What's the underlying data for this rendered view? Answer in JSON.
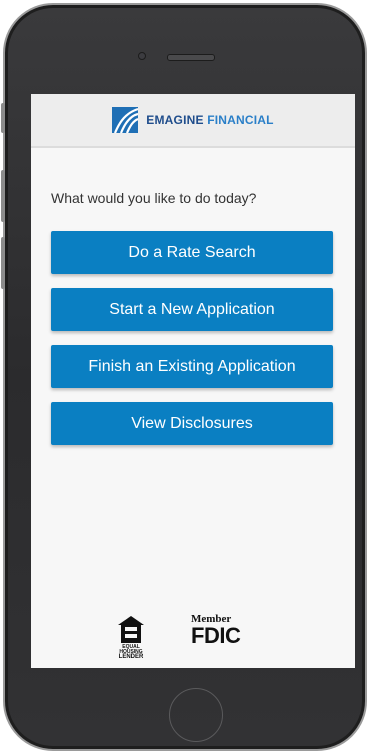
{
  "header": {
    "brand_first": "EMAGINE",
    "brand_second": "FINANCIAL",
    "logo_icon": "emagine-logo-icon"
  },
  "main": {
    "prompt": "What would you like to do today?",
    "actions": [
      {
        "label": "Do a Rate Search"
      },
      {
        "label": "Start a New Application"
      },
      {
        "label": "Finish an Existing Application"
      },
      {
        "label": "View Disclosures"
      }
    ]
  },
  "footer": {
    "equal_housing_line1": "EQUAL HOUSING",
    "equal_housing_line2": "LENDER",
    "fdic_member": "Member",
    "fdic_name": "FDIC"
  },
  "colors": {
    "button": "#0a7fc2",
    "brand": "#1f4d8c",
    "screen_bg": "#f7f7f7"
  }
}
